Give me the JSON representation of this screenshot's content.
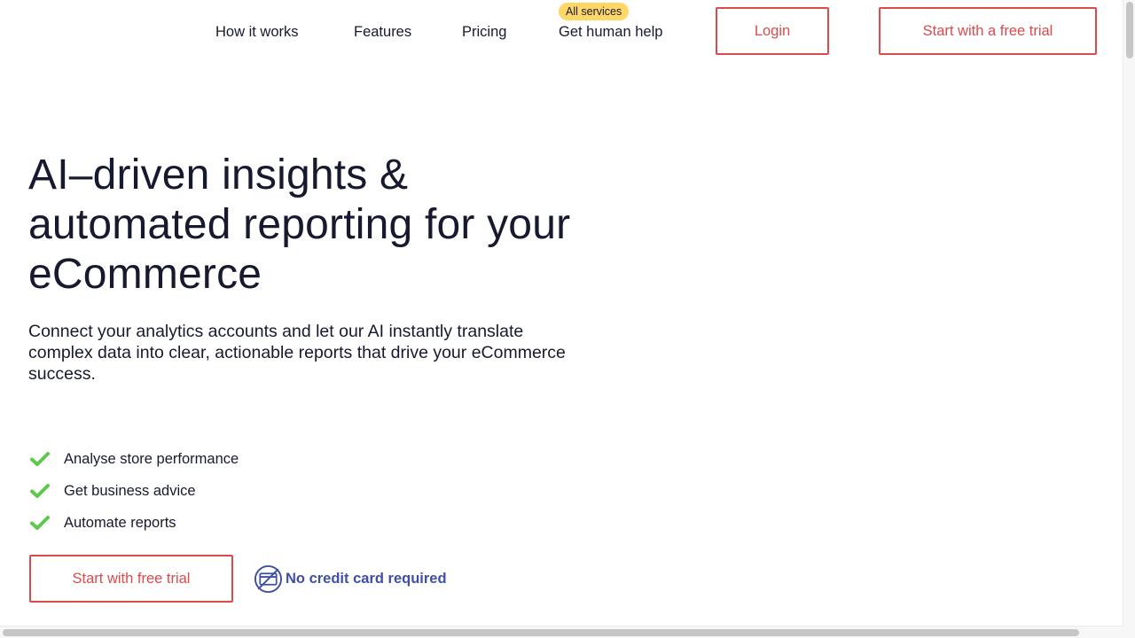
{
  "nav": {
    "how_it_works": "How it works",
    "features": "Features",
    "pricing": "Pricing",
    "human_help": "Get human help",
    "human_help_badge": "All services",
    "login": "Login",
    "free_trial": "Start with a free trial"
  },
  "hero": {
    "title": "AI–driven insights & automated reporting for your eCommerce",
    "subtitle": "Connect your analytics accounts and let our AI instantly translate complex data into clear, actionable reports that drive your eCommerce success.",
    "features": [
      "Analyse store performance",
      "Get business advice",
      "Automate reports"
    ],
    "cta": "Start with free trial",
    "no_card": "No credit card required"
  },
  "icons": {
    "feature": "check-icon",
    "no_card": "no-credit-card-icon"
  },
  "colors": {
    "accent": "#dc4a4c",
    "check": "#5cc94e",
    "badge": "#ffd766",
    "link_blue": "#3f4fa8",
    "text": "#171a2e"
  }
}
